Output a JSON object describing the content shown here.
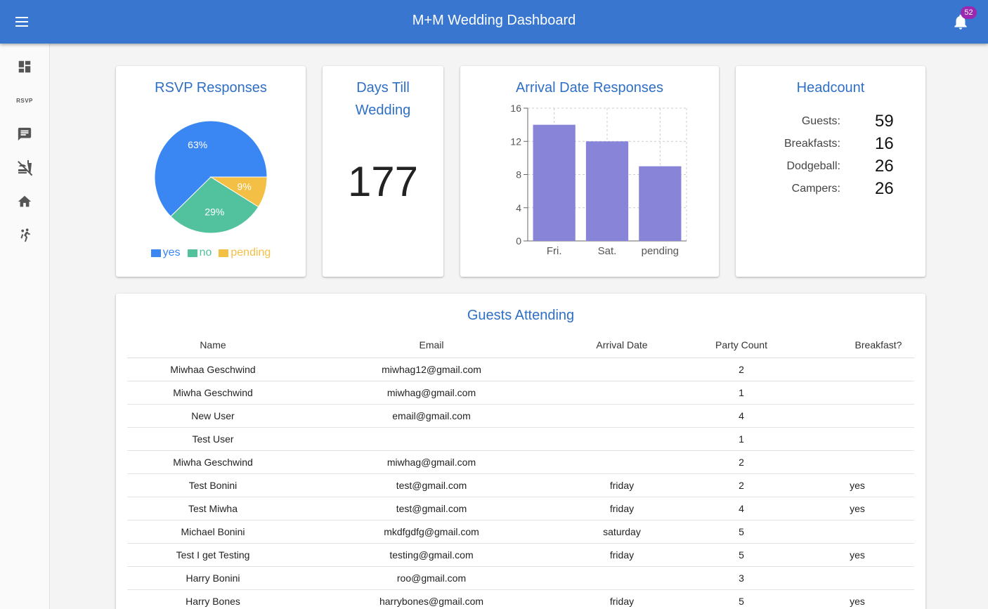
{
  "header": {
    "title": "M+M Wedding Dashboard",
    "notification_count": "52"
  },
  "sidebar": {
    "items": [
      {
        "name": "dashboard",
        "icon": "dashboard-icon"
      },
      {
        "name": "rsvp",
        "label": "RSVP"
      },
      {
        "name": "messages",
        "icon": "message-icon"
      },
      {
        "name": "food",
        "icon": "no-food-icon"
      },
      {
        "name": "lodging",
        "icon": "home-icon"
      },
      {
        "name": "dodgeball",
        "icon": "sports-handball-icon"
      }
    ]
  },
  "rsvp": {
    "title": "RSVP Responses",
    "legend": [
      "yes",
      "no",
      "pending"
    ]
  },
  "days": {
    "title": "Days Till Wedding",
    "value": "177"
  },
  "arrival": {
    "title": "Arrival Date Responses"
  },
  "headcount": {
    "title": "Headcount",
    "rows": [
      {
        "label": "Guests:",
        "value": "59"
      },
      {
        "label": "Breakfasts:",
        "value": "16"
      },
      {
        "label": "Dodgeball:",
        "value": "26"
      },
      {
        "label": "Campers:",
        "value": "26"
      }
    ]
  },
  "guests": {
    "title": "Guests Attending",
    "columns": [
      "Name",
      "Email",
      "Arrival Date",
      "Party Count",
      "Breakfast?"
    ],
    "rows": [
      [
        "Miwhaa Geschwind",
        "miwhag12@gmail.com",
        "",
        "2",
        ""
      ],
      [
        "Miwha Geschwind",
        "miwhag@gmail.com",
        "",
        "1",
        ""
      ],
      [
        "New User",
        "email@gmail.com",
        "",
        "4",
        ""
      ],
      [
        "Test User",
        "",
        "",
        "1",
        ""
      ],
      [
        "Miwha Geschwind",
        "miwhag@gmail.com",
        "",
        "2",
        ""
      ],
      [
        "Test Bonini",
        "test@gmail.com",
        "friday",
        "2",
        "yes"
      ],
      [
        "Test Miwha",
        "test@gmail.com",
        "friday",
        "4",
        "yes"
      ],
      [
        "Michael Bonini",
        "mkdfgdfg@gmail.com",
        "saturday",
        "5",
        ""
      ],
      [
        "Test I get Testing",
        "testing@gmail.com",
        "friday",
        "5",
        "yes"
      ],
      [
        "Harry Bonini",
        "roo@gmail.com",
        "",
        "3",
        ""
      ],
      [
        "Harry Bones",
        "harrybones@gmail.com",
        "friday",
        "5",
        "yes"
      ]
    ]
  },
  "chart_data": [
    {
      "type": "pie",
      "title": "RSVP Responses",
      "categories": [
        "yes",
        "no",
        "pending"
      ],
      "values": [
        63,
        29,
        9
      ],
      "labels": [
        "63%",
        "29%",
        "9%"
      ],
      "colors": [
        "#3a86f2",
        "#52c19d",
        "#f4bf45"
      ],
      "legend": "bottom"
    },
    {
      "type": "bar",
      "title": "Arrival Date Responses",
      "categories": [
        "Fri.",
        "Sat.",
        "pending"
      ],
      "values": [
        14,
        12,
        9
      ],
      "ylim": [
        0,
        16
      ],
      "yticks": [
        0,
        4,
        8,
        12,
        16
      ],
      "grid": true,
      "color": "#8884d8"
    }
  ]
}
